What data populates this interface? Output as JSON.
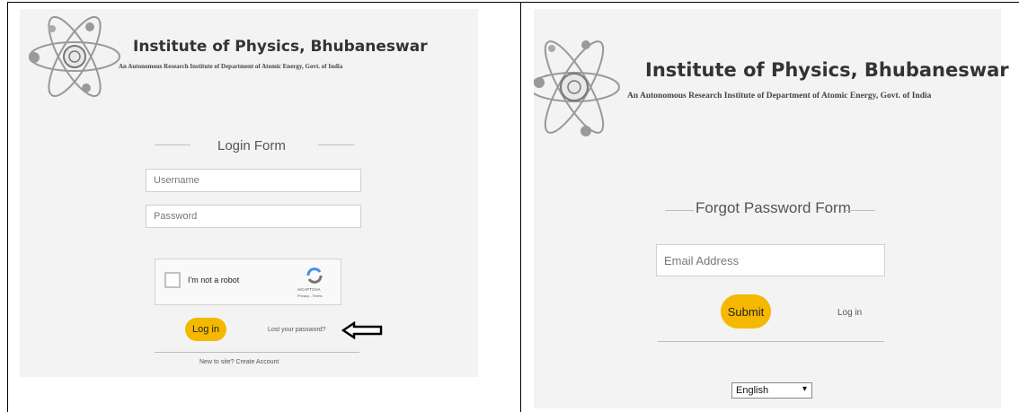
{
  "left_page": {
    "org_title": "Institute of Physics, Bhubaneswar",
    "org_subtitle": "An Autonomous Research Institute of Department of Atomic Energy, Govt. of India",
    "form_title": "Login Form",
    "username_placeholder": "Username",
    "password_placeholder": "Password",
    "captcha": {
      "label": "I'm not a robot",
      "brand": "reCAPTCHA",
      "links": "Privacy - Terms"
    },
    "login_button": "Log in",
    "lost_password_link": "Lost your password?",
    "create_account_text": "New to site? Create Account"
  },
  "right_page": {
    "org_title": "Institute of Physics, Bhubaneswar",
    "org_subtitle": "An Autonomous Research Institute of Department of Atomic Energy, Govt. of India",
    "form_title": "Forgot Password Form",
    "email_placeholder": "Email Address",
    "submit_button": "Submit",
    "login_link": "Log in",
    "language_select": "English"
  },
  "colors": {
    "button": "#f5b800",
    "panel_bg": "#f3f3f3"
  }
}
